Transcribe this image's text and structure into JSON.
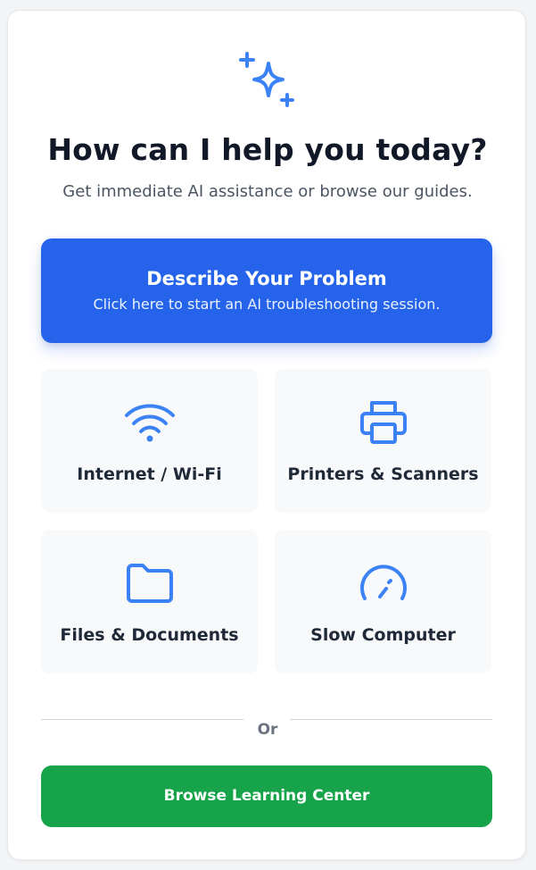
{
  "header": {
    "icon": "sparkles-icon",
    "title": "How can I help you today?",
    "subtitle": "Get immediate AI assistance or browse our guides."
  },
  "primary_action": {
    "title": "Describe Your Problem",
    "subtitle": "Click here to start an AI troubleshooting session."
  },
  "categories": [
    {
      "label": "Internet / Wi-Fi",
      "icon": "wifi-icon"
    },
    {
      "label": "Printers & Scanners",
      "icon": "printer-icon"
    },
    {
      "label": "Files & Documents",
      "icon": "folder-icon"
    },
    {
      "label": "Slow Computer",
      "icon": "speedometer-icon"
    }
  ],
  "divider": {
    "label": "Or"
  },
  "secondary_action": {
    "label": "Browse Learning Center"
  },
  "colors": {
    "primary": "#2563eb",
    "secondary": "#16a34a",
    "icon": "#3b82f6",
    "title": "#111827"
  }
}
